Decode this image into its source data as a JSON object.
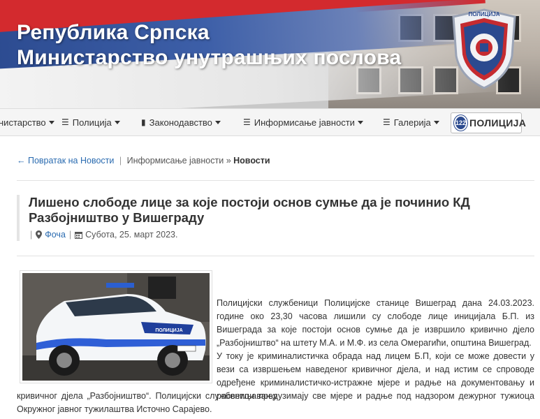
{
  "header": {
    "title_line1": "Република Српска",
    "title_line2": "Министарство унутрашњих послова",
    "badge_text": "ПОЛИЦИЈА"
  },
  "nav": {
    "items": [
      {
        "label": "нистарство",
        "icon": "none"
      },
      {
        "label": "Полиција",
        "icon": "list-icon"
      },
      {
        "label": "Законодавство",
        "icon": "book-icon"
      },
      {
        "label": "Информисање јавности",
        "icon": "list-icon"
      },
      {
        "label": "Галерија",
        "icon": "list-icon"
      }
    ],
    "button": {
      "number": "122",
      "label": "ПОЛИЦИЈА"
    }
  },
  "breadcrumb": {
    "back_link": "← Повратак на Новости",
    "separator": "|",
    "parent": "Информисање јавности",
    "arrow": "»",
    "current": "Новости"
  },
  "article": {
    "title": "Лишено слободе лице за које постоји основ сумње да је починио КД Разбојништво у Вишеграду",
    "location": "Фоча",
    "date": "Субота, 25. март 2023.",
    "p1": "Полицијски службеници Полицијске станице Вишеград  дана 24.03.2023. године око 23,30 часова лишили су слободе лице иницијала Б.П. из Вишеграда за које постоји основ сумње да је извршило кривично дјело „Разбојништво“ на штету М.А. и М.Ф. из села Омерагићи, општина Вишеград.",
    "p2": "У току је криминалистичка обрада над лицем Б.П, који се може довести у вези са извршењем наведеног кривичног дјела, и над истим се спроводе одређене криминалистичко-истражне мјере и радње на документовању и расветљавању",
    "p3": "кривичног дјела „Разбојништво“. Полицијски службеници предузимају све мјере и радње под надзором дежурног тужиоца Окружног јавног тужилаштва Источно Сарајево.",
    "photo_plate": "ПОЛИЦИЈА"
  },
  "colors": {
    "flag_red": "#d32a2e",
    "flag_blue": "#2b4a8f",
    "link": "#2a6bb0"
  }
}
